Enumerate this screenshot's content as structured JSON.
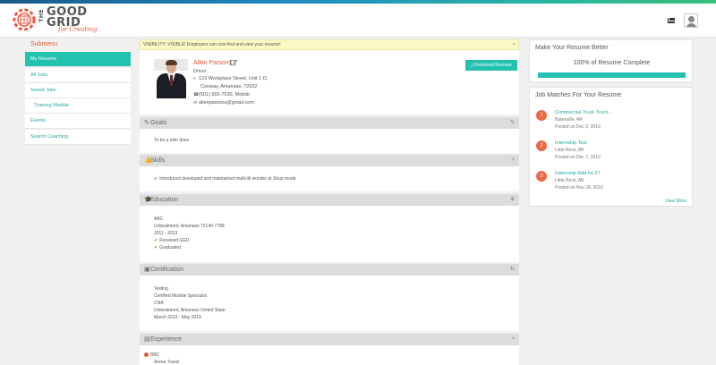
{
  "colors": {
    "accent": "#22c1b0",
    "brand_red": "#e05a3a",
    "header_bg": "#dcdcdc"
  },
  "brand": {
    "line1": "THE",
    "line2": "GOOD",
    "line3": "GRID",
    "tagline": "for Creating"
  },
  "header": {
    "mail_icon": "envelope-icon",
    "user_icon": "user-icon"
  },
  "sidebar": {
    "title": "Submenu",
    "items": [
      {
        "label": "My Resume",
        "active": true
      },
      {
        "label": "All Jobs"
      },
      {
        "label": "Saved Jobs"
      },
      {
        "label": "Training Module",
        "sub": true
      },
      {
        "label": "Events"
      },
      {
        "label": "Search Coaching"
      }
    ]
  },
  "notice": {
    "text": "VISIBILITY: VISIBLE! Employers can now find and view your resume!",
    "close": "×"
  },
  "profile": {
    "name": "Allen Parsons",
    "role": "Driver",
    "address1": "123 Workplace Street, Unit 1 D,",
    "address2": "Conway, Arkansas, 72032",
    "phone": "(501) 555-7530, Mobile",
    "email": "allenparsons@gmail.com",
    "download_label": "Download Resume"
  },
  "sections": {
    "goals": {
      "title": "Goals",
      "lines": [
        "To be a dish drive"
      ]
    },
    "skills": {
      "title": "Skills",
      "lines": [
        "Introduced developed and maintained multi-ilk wonder at Shop mode"
      ]
    },
    "education": {
      "title": "Education",
      "lines": [
        "ABC",
        "Unbeatment, Arkansas 72140-7788",
        "2011 - 2013"
      ],
      "checks": [
        "Received GED",
        "Graduated"
      ]
    },
    "certification": {
      "title": "Certification",
      "lines": [
        "Testing",
        "Certified Module Specialist",
        "CNA",
        "Unbeatment, Arkansas United State",
        "March 2013 - May 2019"
      ]
    },
    "experience": {
      "title": "Experience",
      "first_item": "BBC",
      "first_sub": "Arena Travel"
    }
  },
  "completion": {
    "title": "Make Your Resume Better",
    "percent_label": "100% of Resume Complete",
    "percent": 100
  },
  "jobs": {
    "title": "Job Matches For Your Resume",
    "items": [
      {
        "n": "1",
        "title": "Commercial Truck Truck...",
        "location": "Batesville, AR",
        "date": "Posted on Dec 9, 2019"
      },
      {
        "n": "2",
        "title": "Internship Test",
        "location": "Little Rock, AR",
        "date": "Posted on Dec 7, 2019"
      },
      {
        "n": "3",
        "title": "Internship Add-ho 27",
        "location": "Little Rock, AR",
        "date": "Posted on Nov 28, 2019"
      }
    ],
    "view_more": "View More"
  }
}
